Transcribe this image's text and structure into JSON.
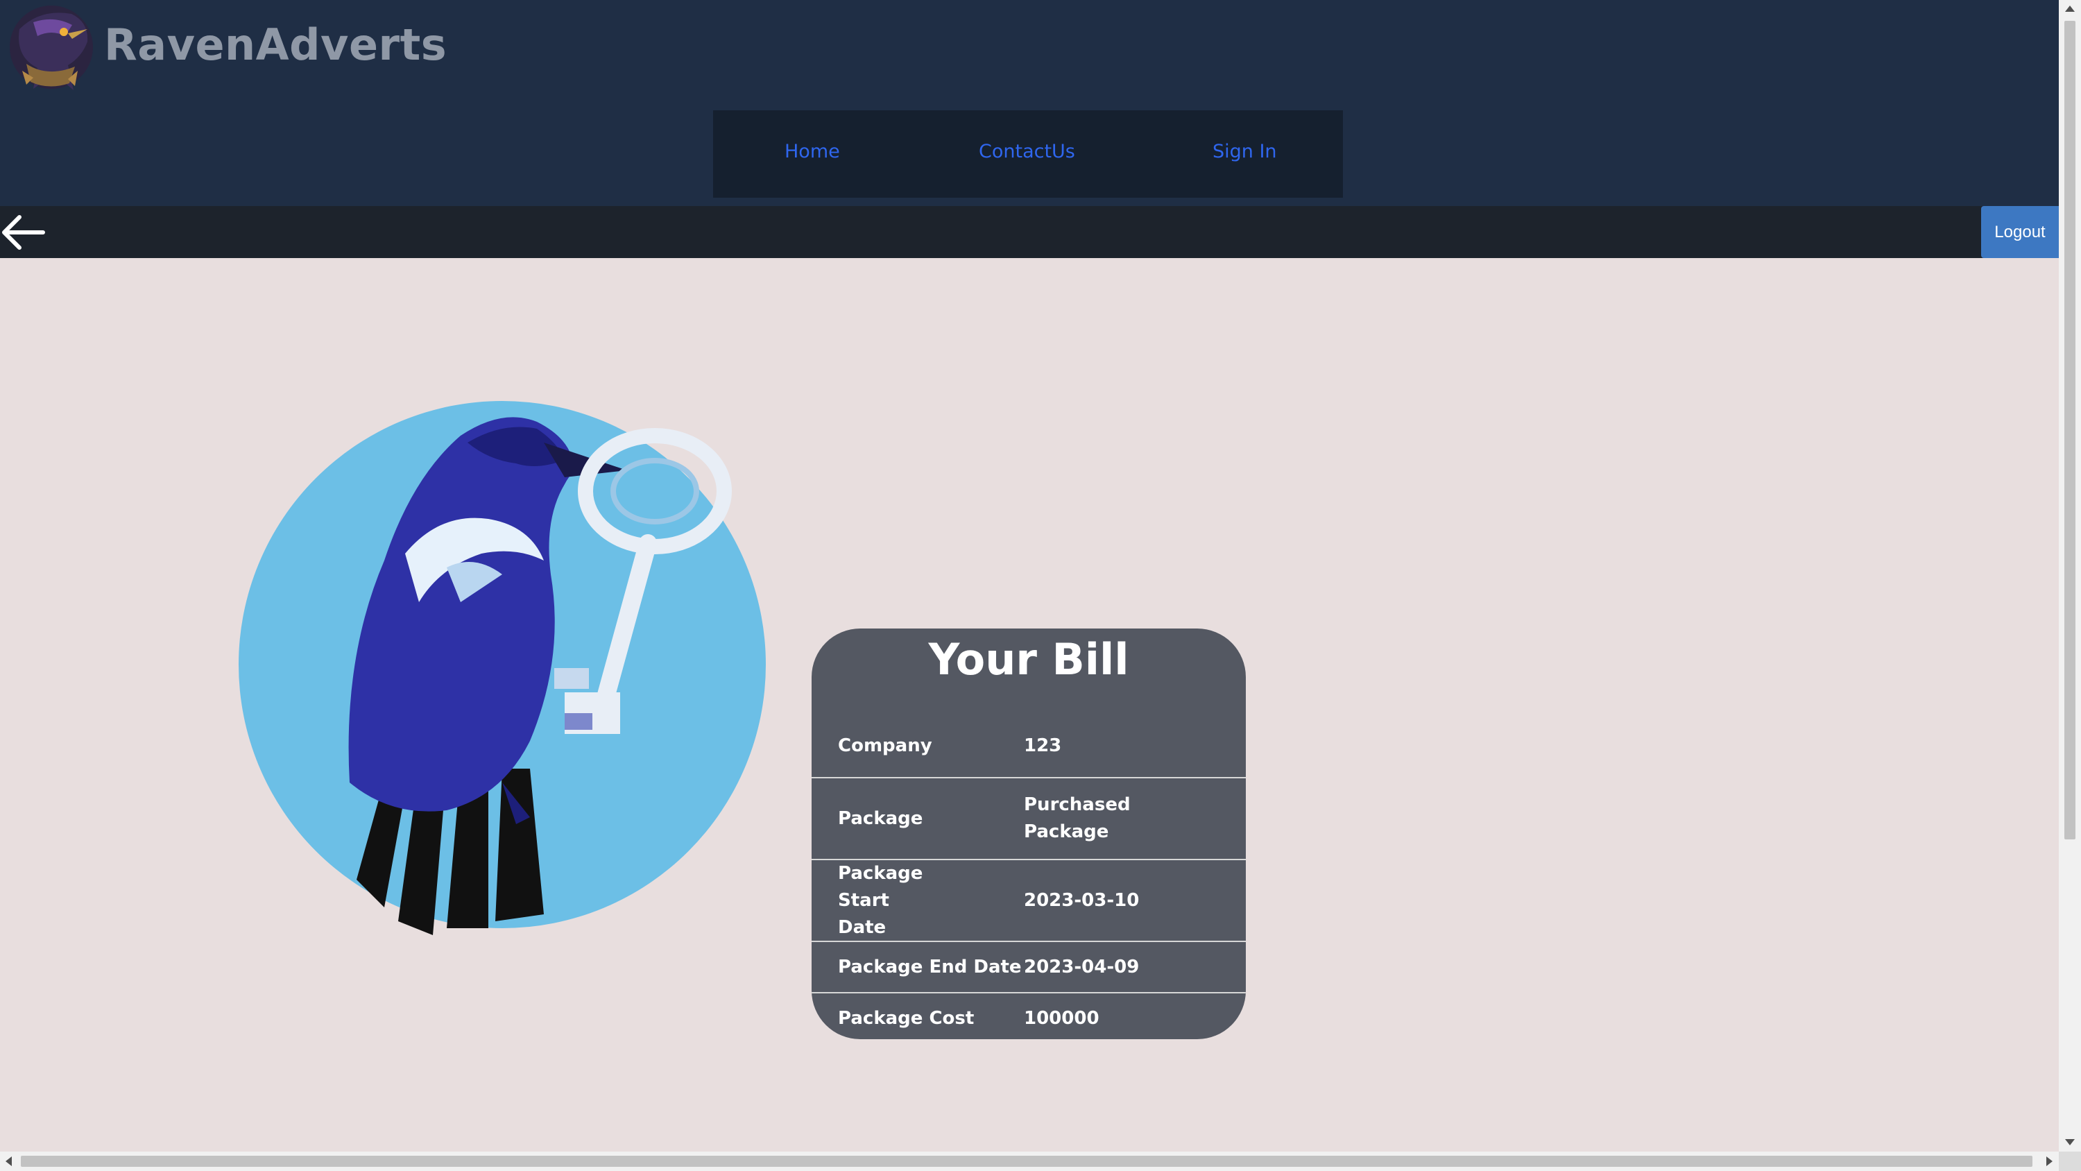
{
  "header": {
    "brand": "RavenAdverts",
    "logo_icon": "raven-logo-icon"
  },
  "nav": {
    "items": [
      {
        "label": "Home"
      },
      {
        "label": "ContactUs"
      },
      {
        "label": "Sign In"
      }
    ]
  },
  "toolbar": {
    "back_icon": "arrow-left-icon",
    "logout_label": "Logout"
  },
  "bill": {
    "title": "Your Bill",
    "rows": [
      {
        "label": "Company",
        "value": "123"
      },
      {
        "label": "Package",
        "value": "Purchased Package"
      },
      {
        "label": "Package Start Date",
        "value": "2023-03-10"
      },
      {
        "label": "Package End Date",
        "value": "2023-04-09"
      },
      {
        "label": "Package Cost",
        "value": "100000"
      }
    ]
  },
  "colors": {
    "header_bg": "#1f2e45",
    "nav_bg": "#15202f",
    "nav_link": "#2f66ee",
    "toolbar_bg": "#1d232c",
    "logout_bg": "#3d78c2",
    "page_bg": "#e8dede",
    "card_bg": "#545862",
    "art_circle": "#6cbfe6",
    "raven_body": "#2e31a6"
  }
}
